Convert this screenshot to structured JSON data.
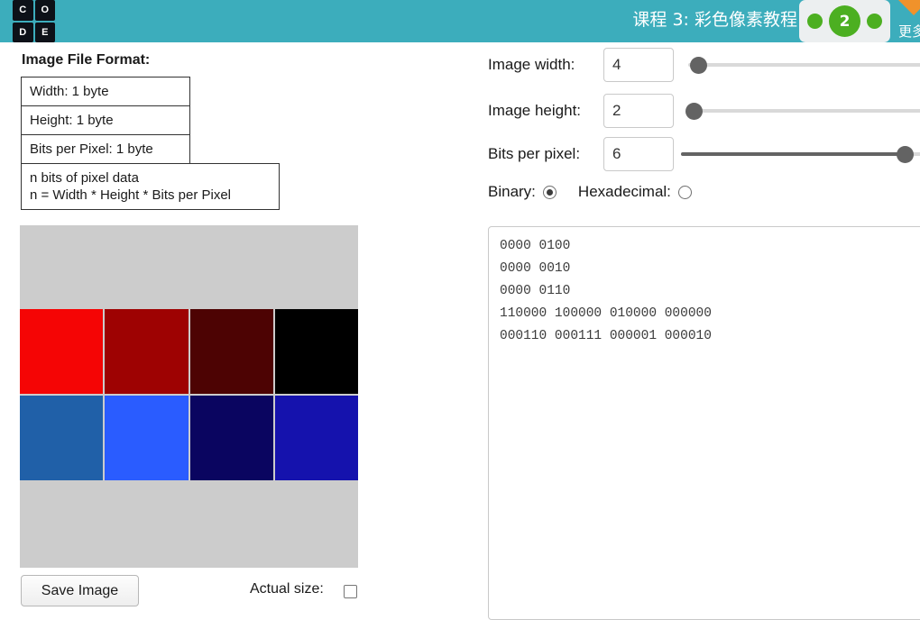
{
  "header": {
    "logo_tiles": [
      "C",
      "O",
      "D",
      "E"
    ],
    "title": "课程 3: 彩色像素教程",
    "progress_badge": "2",
    "more_label": "更多",
    "teal_color": "#3cadbc",
    "badge_green": "#4caf21",
    "more_triangle_color": "#f0922b"
  },
  "left_panel": {
    "format_title": "Image File Format:",
    "format_rows": [
      "Width: 1 byte",
      "Height: 1 byte",
      "Bits per Pixel: 1 byte"
    ],
    "format_note_line1": "n bits of pixel data",
    "format_note_line2": "n = Width * Height * Bits per Pixel",
    "canvas_background": "#cccccc",
    "save_button": "Save Image",
    "actual_size_label": "Actual size:",
    "actual_size_checked": false,
    "pixels": [
      "#f50505",
      "#9e0202",
      "#4d0303",
      "#000000",
      "#2060a8",
      "#2a5cff",
      "#0a0560",
      "#1512ad"
    ]
  },
  "controls": {
    "width": {
      "label": "Image width:",
      "value": "4",
      "slider_percent": 8
    },
    "height": {
      "label": "Image height:",
      "value": "2",
      "slider_percent": 4
    },
    "bits": {
      "label": "Bits per pixel:",
      "value": "6",
      "slider_percent": 94
    },
    "binary_label": "Binary:",
    "hexadecimal_label": "Hexadecimal:",
    "binary_selected": true,
    "hexadecimal_selected": false
  },
  "data_output": {
    "lines": [
      "0000 0100",
      "0000 0010",
      "0000 0110",
      "110000 100000 010000 000000",
      "000110 000111 000001 000010"
    ]
  }
}
